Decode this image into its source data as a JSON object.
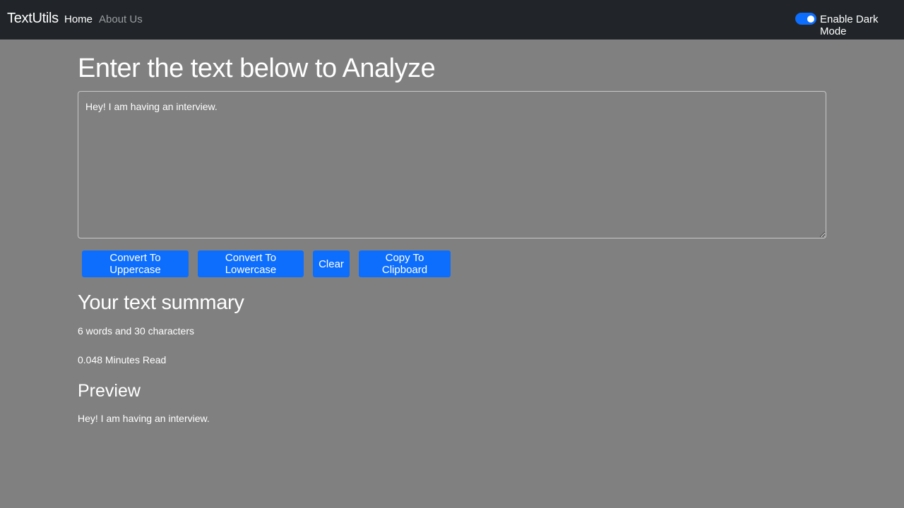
{
  "navbar": {
    "brand": "TextUtils",
    "links": [
      {
        "label": "Home",
        "active": true
      },
      {
        "label": "About Us",
        "active": false
      }
    ],
    "dark_mode_toggle": {
      "label": "Enable Dark Mode",
      "checked": true
    }
  },
  "main": {
    "heading": "Enter the text below to Analyze",
    "textarea_value": "Hey! I am having an interview.",
    "buttons": {
      "uppercase": "Convert To Uppercase",
      "lowercase": "Convert To Lowercase",
      "clear": "Clear",
      "copy": "Copy To Clipboard"
    }
  },
  "summary": {
    "heading": "Your text summary",
    "counts": "6 words and 30 characters",
    "read_time": "0.048 Minutes Read"
  },
  "preview": {
    "heading": "Preview",
    "text": "Hey! I am having an interview."
  },
  "colors": {
    "background": "#808080",
    "navbar": "#212529",
    "accent": "#0d6efd"
  }
}
